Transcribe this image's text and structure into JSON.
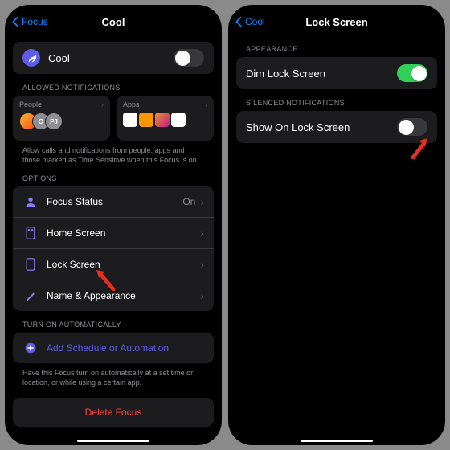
{
  "left": {
    "back": "Focus",
    "title": "Cool",
    "focus_name": "Cool",
    "allowed_label": "ALLOWED NOTIFICATIONS",
    "people_label": "People",
    "apps_label": "Apps",
    "allow_footer": "Allow calls and notifications from people, apps and those marked as Time Sensitive when this Focus is on.",
    "options_label": "OPTIONS",
    "options": {
      "focus_status": "Focus Status",
      "focus_status_val": "On",
      "home_screen": "Home Screen",
      "lock_screen": "Lock Screen",
      "name_appearance": "Name & Appearance"
    },
    "auto_label": "TURN ON AUTOMATICALLY",
    "add_schedule": "Add Schedule or Automation",
    "auto_footer": "Have this Focus turn on automatically at a set time or location, or while using a certain app.",
    "delete": "Delete Focus"
  },
  "right": {
    "back": "Cool",
    "title": "Lock Screen",
    "appearance_label": "APPEARANCE",
    "dim": "Dim Lock Screen",
    "silenced_label": "SILENCED NOTIFICATIONS",
    "show": "Show On Lock Screen"
  }
}
